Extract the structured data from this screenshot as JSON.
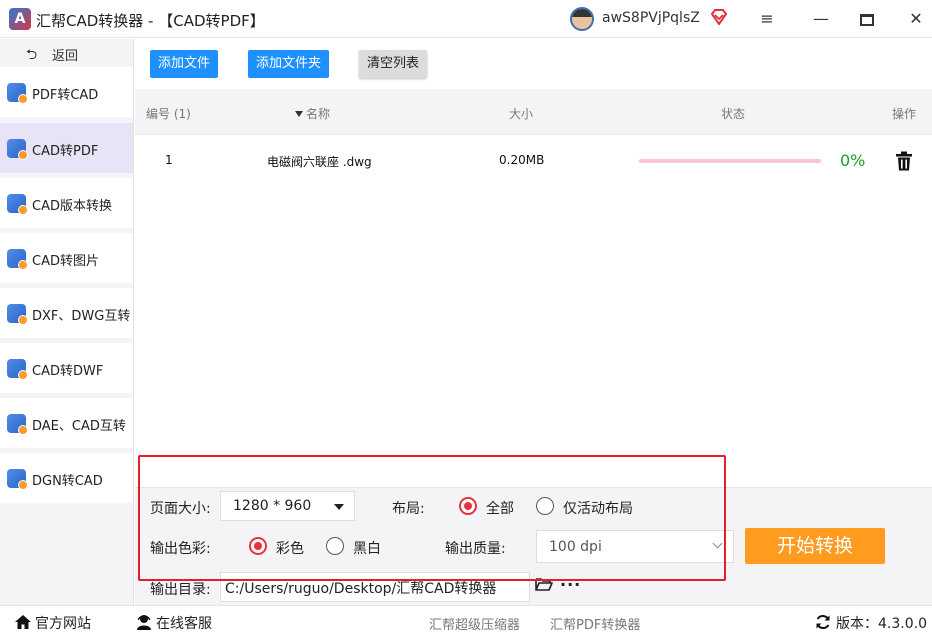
{
  "window": {
    "title": "汇帮CAD转换器 - 【CAD转PDF】",
    "logo_letter": "A",
    "username": "awS8PVjPqlsZ",
    "menu_icon": "≡",
    "minimize_icon": "—",
    "close_icon": "✕"
  },
  "sidebar": {
    "back_label": "返回",
    "back_icon": "⮌",
    "items": [
      {
        "label": "PDF转CAD",
        "active": false
      },
      {
        "label": "CAD转PDF",
        "active": true
      },
      {
        "label": "CAD版本转换",
        "active": false
      },
      {
        "label": "CAD转图片",
        "active": false
      },
      {
        "label": "DXF、DWG互转",
        "active": false
      },
      {
        "label": "CAD转DWF",
        "active": false
      },
      {
        "label": "DAE、CAD互转",
        "active": false
      },
      {
        "label": "DGN转CAD",
        "active": false
      }
    ]
  },
  "toolbar": {
    "add_file": "添加文件",
    "add_folder": "添加文件夹",
    "clear_list": "清空列表"
  },
  "table": {
    "headers": {
      "index": "编号 (1)",
      "name": "名称",
      "size": "大小",
      "status": "状态",
      "action": "操作"
    },
    "rows": [
      {
        "index": "1",
        "name": "电磁阀六联座 .dwg",
        "size": "0.20MB",
        "progress": 0,
        "percent": "0%"
      }
    ]
  },
  "settings": {
    "page_size_label": "页面大小:",
    "page_size_value": "1280 * 960",
    "layout_label": "布局:",
    "layout_options": [
      {
        "label": "全部",
        "selected": true
      },
      {
        "label": "仅活动布局",
        "selected": false
      }
    ],
    "color_label": "输出色彩:",
    "color_options": [
      {
        "label": "彩色",
        "selected": true
      },
      {
        "label": "黑白",
        "selected": false
      }
    ],
    "quality_label": "输出质量:",
    "quality_value": "100 dpi",
    "output_dir_label": "输出目录:",
    "output_dir_value": "C:/Users/ruguo/Desktop/汇帮CAD转换器",
    "more_label": "···",
    "start_button": "开始转换"
  },
  "footer": {
    "website": "官方网站",
    "support": "在线客服",
    "link1": "汇帮超级压缩器",
    "link2": "汇帮PDF转换器",
    "version": "版本：4.3.0.0"
  },
  "colors": {
    "accent_blue": "#1e90ff",
    "start_orange": "#ff9b1f",
    "radio_red": "#e8303c",
    "highlight_red": "#e0202a",
    "percent_green": "#1f9c2e",
    "active_nav": "#e8e3f6"
  }
}
